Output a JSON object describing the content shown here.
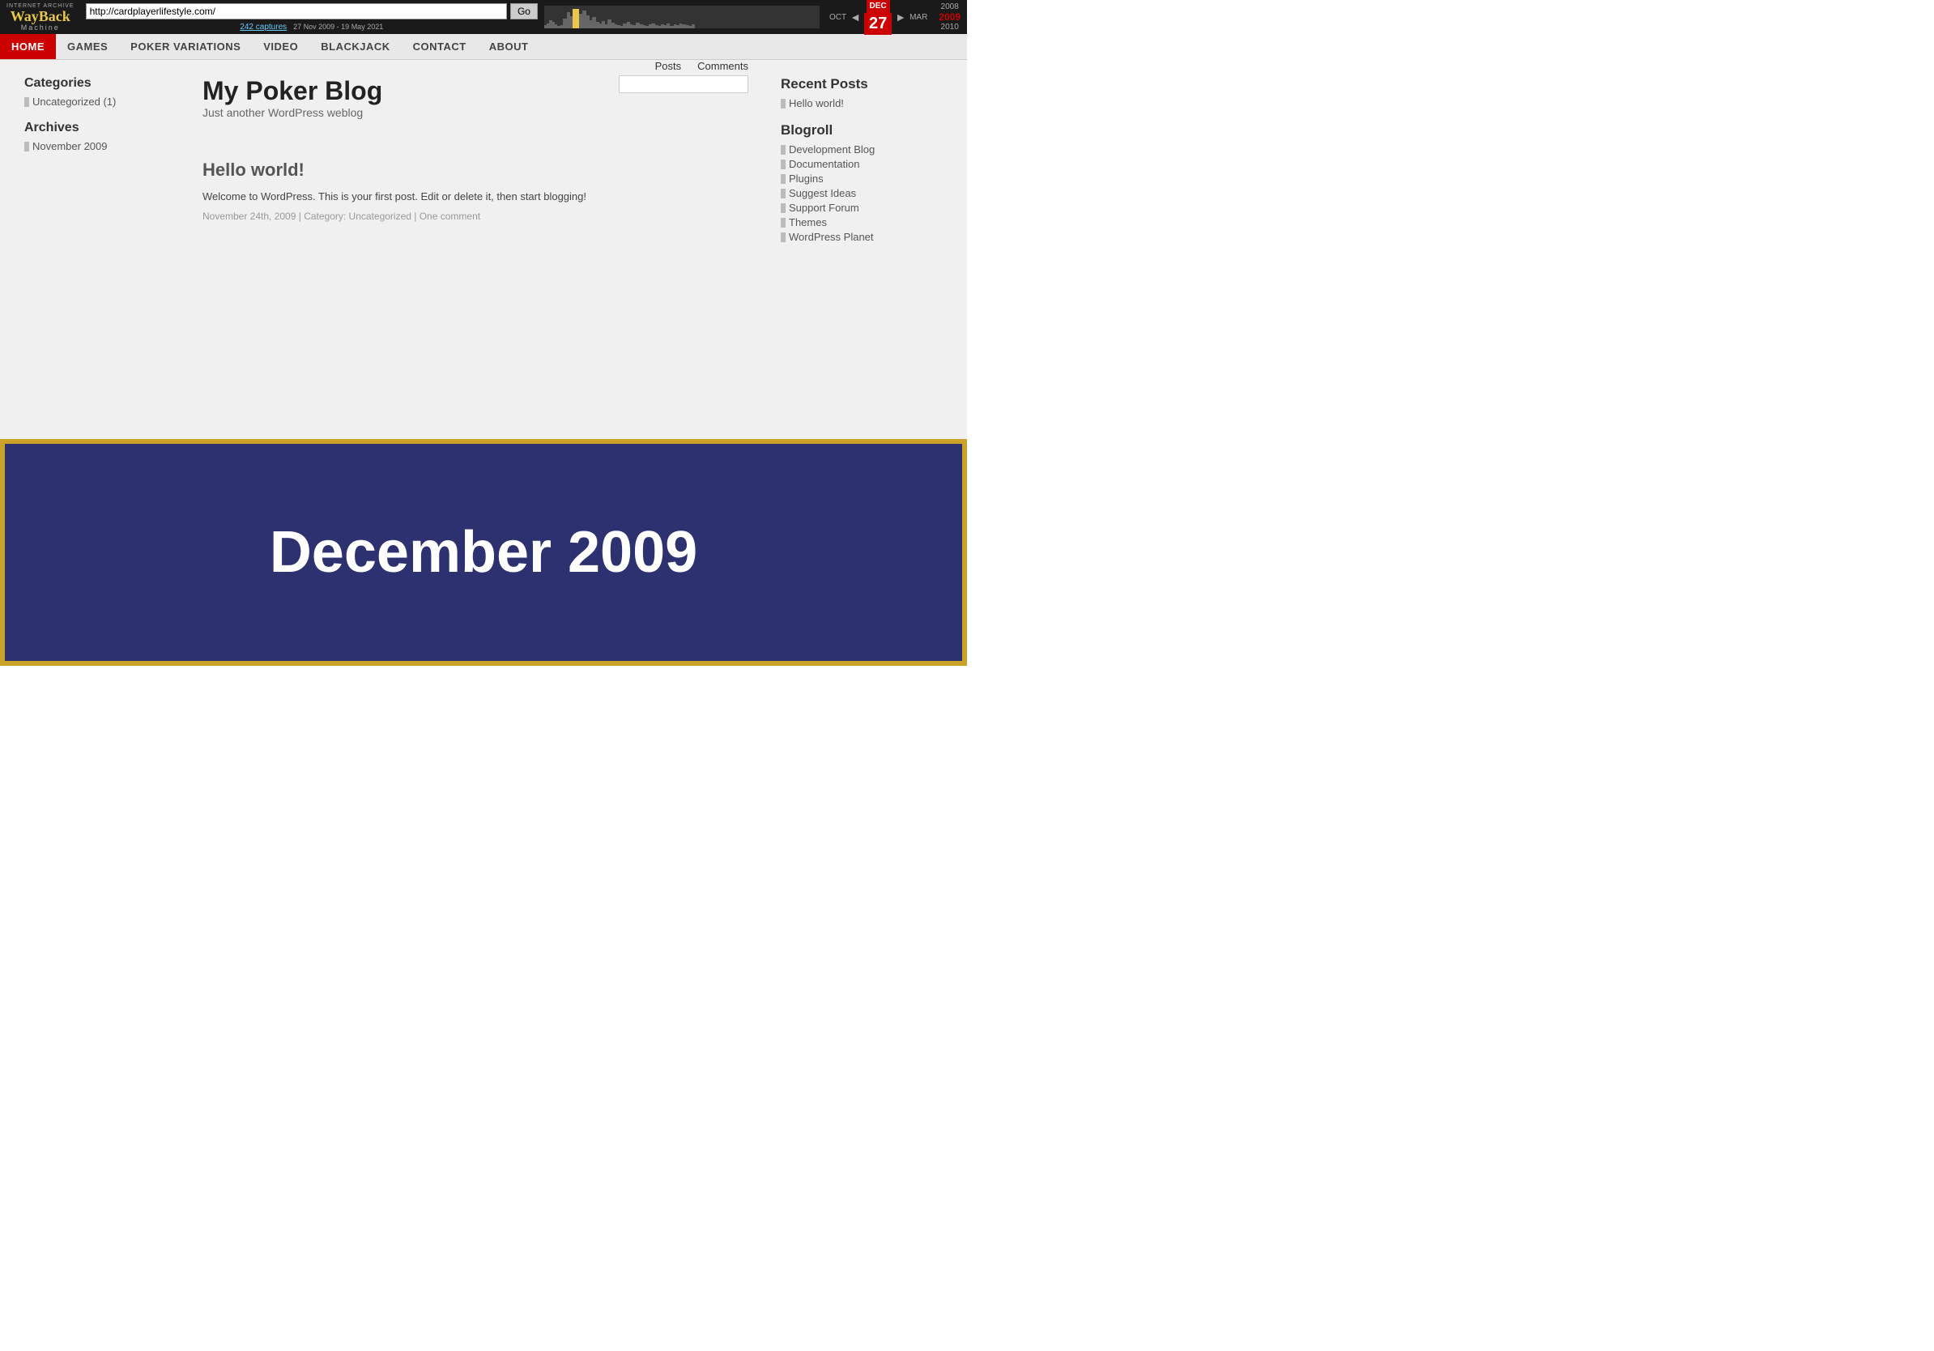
{
  "wayback": {
    "url": "http://cardplayerlifestyle.com/",
    "go_label": "Go",
    "captures_label": "242 captures",
    "captures_date": "27 Nov 2009 - 19 May 2021",
    "oct_label": "OCT",
    "dec_label": "DEC",
    "day": "27",
    "mar_label": "MAR",
    "year_prev": "2008",
    "year_current": "2009",
    "year_next": "2010"
  },
  "nav": {
    "items": [
      {
        "label": "HOME",
        "active": true
      },
      {
        "label": "GAMES",
        "active": false
      },
      {
        "label": "POKER VARIATIONS",
        "active": false
      },
      {
        "label": "VIDEO",
        "active": false
      },
      {
        "label": "BLACKJACK",
        "active": false
      },
      {
        "label": "CONTACT",
        "active": false
      },
      {
        "label": "ABOUT",
        "active": false
      }
    ]
  },
  "blog": {
    "title": "My Poker Blog",
    "subtitle": "Just another WordPress weblog",
    "posts_tab": "Posts",
    "comments_tab": "Comments",
    "search_placeholder": ""
  },
  "left_sidebar": {
    "categories_title": "Categories",
    "categories": [
      {
        "label": "Uncategorized (1)"
      }
    ],
    "archives_title": "Archives",
    "archives": [
      {
        "label": "November 2009"
      }
    ]
  },
  "post": {
    "title": "Hello world!",
    "body": "Welcome to WordPress. This is your first post. Edit or delete it, then start blogging!",
    "meta": "November 24th, 2009 | Category: Uncategorized | One comment"
  },
  "right_sidebar": {
    "recent_posts_title": "Recent Posts",
    "recent_posts": [
      {
        "label": "Hello world!"
      }
    ],
    "blogroll_title": "Blogroll",
    "blogroll": [
      {
        "label": "Development Blog"
      },
      {
        "label": "Documentation"
      },
      {
        "label": "Plugins"
      },
      {
        "label": "Suggest Ideas"
      },
      {
        "label": "Support Forum"
      },
      {
        "label": "Themes"
      },
      {
        "label": "WordPress Planet"
      }
    ]
  },
  "banner": {
    "text": "December 2009"
  }
}
